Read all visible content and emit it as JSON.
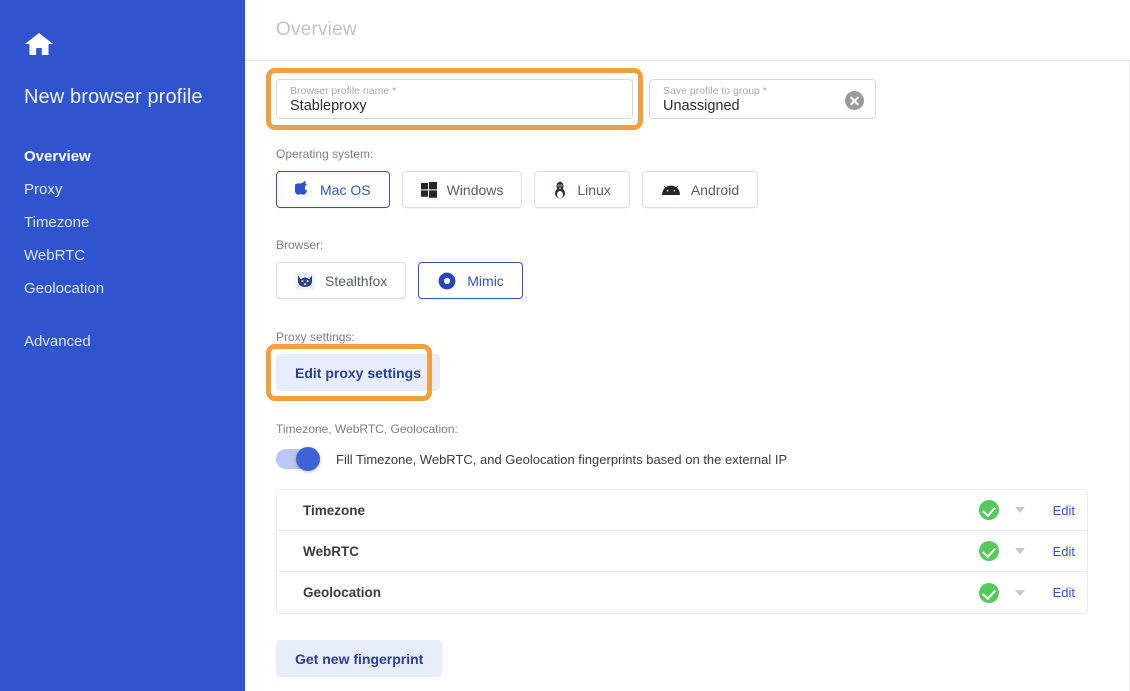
{
  "sidebar": {
    "home_icon": "home-icon",
    "title": "New browser profile",
    "items": [
      {
        "label": "Overview",
        "active": true
      },
      {
        "label": "Proxy",
        "active": false
      },
      {
        "label": "Timezone",
        "active": false
      },
      {
        "label": "WebRTC",
        "active": false
      },
      {
        "label": "Geolocation",
        "active": false
      },
      {
        "label": "Advanced",
        "active": false
      }
    ]
  },
  "header": {
    "title": "Overview"
  },
  "fields": {
    "profile_name": {
      "label": "Browser profile name *",
      "value": "Stableproxy",
      "highlighted": true
    },
    "group": {
      "label": "Save profile to group *",
      "value": "Unassigned",
      "clear_icon": "clear-circle-icon"
    }
  },
  "operating_system": {
    "label": "Operating system:",
    "options": [
      {
        "label": "Mac OS",
        "icon": "apple-icon",
        "selected": true
      },
      {
        "label": "Windows",
        "icon": "windows-icon",
        "selected": false
      },
      {
        "label": "Linux",
        "icon": "linux-penguin-icon",
        "selected": false
      },
      {
        "label": "Android",
        "icon": "android-icon",
        "selected": false
      }
    ]
  },
  "browser": {
    "label": "Browser:",
    "options": [
      {
        "label": "Stealthfox",
        "icon": "fox-icon",
        "selected": false
      },
      {
        "label": "Mimic",
        "icon": "ring-icon",
        "selected": true
      }
    ]
  },
  "proxy": {
    "label": "Proxy settings:",
    "button_label": "Edit proxy settings",
    "highlighted": true
  },
  "fingerprints": {
    "label": "Timezone, WebRTC, Geolocation:",
    "toggle_on": true,
    "toggle_text": "Fill Timezone, WebRTC, and Geolocation fingerprints based on the external IP",
    "rows": [
      {
        "label": "Timezone",
        "status_icon": "green-check-icon",
        "caret_icon": "caret-down-icon",
        "action": "Edit"
      },
      {
        "label": "WebRTC",
        "status_icon": "green-check-icon",
        "caret_icon": "caret-down-icon",
        "action": "Edit"
      },
      {
        "label": "Geolocation",
        "status_icon": "green-check-icon",
        "caret_icon": "caret-down-icon",
        "action": "Edit"
      }
    ],
    "get_fingerprint_label": "Get new fingerprint"
  },
  "colors": {
    "sidebar_blue": "#2f54cf",
    "accent_blue": "#3253c8",
    "highlight_orange": "#f2a03d",
    "status_green": "#56c95c",
    "soft_blue_bg": "#e8edfb"
  }
}
